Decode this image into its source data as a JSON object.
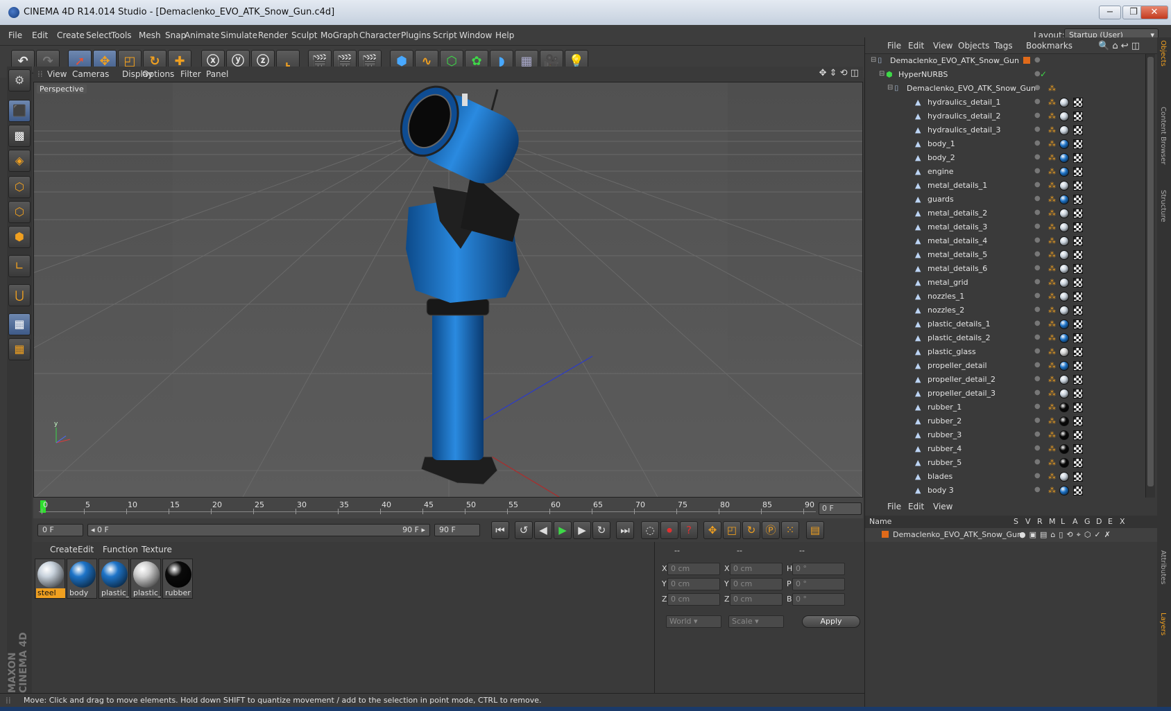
{
  "window": {
    "title": "CINEMA 4D R14.014 Studio - [Demaclenko_EVO_ATK_Snow_Gun.c4d]",
    "minimize": "−",
    "restore": "❐",
    "close": "✕"
  },
  "menubar": {
    "items": [
      "File",
      "Edit",
      "Create",
      "Select",
      "Tools",
      "Mesh",
      "Snap",
      "Animate",
      "Simulate",
      "Render",
      "Sculpt",
      "MoGraph",
      "Character",
      "Plugins",
      "Script",
      "Window",
      "Help"
    ],
    "layout_label": "Layout:",
    "layout_value": "Startup (User)"
  },
  "viewport": {
    "menu": [
      "View",
      "Cameras",
      "Display",
      "Options",
      "Filter",
      "Panel"
    ],
    "label": "Perspective"
  },
  "timeline": {
    "ticks": [
      "0",
      "5",
      "10",
      "15",
      "20",
      "25",
      "30",
      "35",
      "40",
      "45",
      "50",
      "55",
      "60",
      "65",
      "70",
      "75",
      "80",
      "85",
      "90"
    ],
    "current_frame": "0 F"
  },
  "transport": {
    "start_field": "0 F",
    "range_start": "◂ 0 F",
    "range_end": "90 F ▸",
    "end_field": "90 F"
  },
  "materials": {
    "menu": [
      "Create",
      "Edit",
      "Function",
      "Texture"
    ],
    "items": [
      {
        "name": "steel",
        "color": "#c8d2dc"
      },
      {
        "name": "body",
        "color": "#1e74c8"
      },
      {
        "name": "plastic_d",
        "color": "#1e74c8"
      },
      {
        "name": "plastic_g",
        "color": "#d0d0d0"
      },
      {
        "name": "rubber",
        "color": "#0a0a0a"
      }
    ]
  },
  "coordinates": {
    "headers": [
      "--",
      "--",
      "--"
    ],
    "rows": [
      {
        "a": "X",
        "av": "0 cm",
        "b": "X",
        "bv": "0 cm",
        "c": "H",
        "cv": "0 °"
      },
      {
        "a": "Y",
        "av": "0 cm",
        "b": "Y",
        "bv": "0 cm",
        "c": "P",
        "cv": "0 °"
      },
      {
        "a": "Z",
        "av": "0 cm",
        "b": "Z",
        "bv": "0 cm",
        "c": "B",
        "cv": "0 °"
      }
    ],
    "mode": "World",
    "scale": "Scale",
    "apply": "Apply"
  },
  "objects": {
    "menu": [
      "File",
      "Edit",
      "View",
      "Objects",
      "Tags",
      "Bookmarks"
    ],
    "items": [
      {
        "name": "Demaclenko_EVO_ATK_Snow_Gun",
        "indent": 0,
        "type": "null"
      },
      {
        "name": "HyperNURBS",
        "indent": 1,
        "type": "nurbs"
      },
      {
        "name": "Demaclenko_EVO_ATK_Snow_Gun",
        "indent": 2,
        "type": "null"
      },
      {
        "name": "hydraulics_detail_1",
        "indent": 3,
        "type": "poly",
        "mat": "#c8d2dc"
      },
      {
        "name": "hydraulics_detail_2",
        "indent": 3,
        "type": "poly",
        "mat": "#c8d2dc"
      },
      {
        "name": "hydraulics_detail_3",
        "indent": 3,
        "type": "poly",
        "mat": "#c8d2dc"
      },
      {
        "name": "body_1",
        "indent": 3,
        "type": "poly",
        "mat": "#1e74c8"
      },
      {
        "name": "body_2",
        "indent": 3,
        "type": "poly",
        "mat": "#1e74c8"
      },
      {
        "name": "engine",
        "indent": 3,
        "type": "poly",
        "mat": "#1e74c8"
      },
      {
        "name": "metal_details_1",
        "indent": 3,
        "type": "poly",
        "mat": "#c8d2dc"
      },
      {
        "name": "guards",
        "indent": 3,
        "type": "poly",
        "mat": "#1e74c8"
      },
      {
        "name": "metal_details_2",
        "indent": 3,
        "type": "poly",
        "mat": "#c8d2dc"
      },
      {
        "name": "metal_details_3",
        "indent": 3,
        "type": "poly",
        "mat": "#c8d2dc"
      },
      {
        "name": "metal_details_4",
        "indent": 3,
        "type": "poly",
        "mat": "#c8d2dc"
      },
      {
        "name": "metal_details_5",
        "indent": 3,
        "type": "poly",
        "mat": "#c8d2dc"
      },
      {
        "name": "metal_details_6",
        "indent": 3,
        "type": "poly",
        "mat": "#c8d2dc"
      },
      {
        "name": "metal_grid",
        "indent": 3,
        "type": "poly",
        "mat": "#c8d2dc"
      },
      {
        "name": "nozzles_1",
        "indent": 3,
        "type": "poly",
        "mat": "#c8d2dc"
      },
      {
        "name": "nozzles_2",
        "indent": 3,
        "type": "poly",
        "mat": "#c8d2dc"
      },
      {
        "name": "plastic_details_1",
        "indent": 3,
        "type": "poly",
        "mat": "#1e74c8"
      },
      {
        "name": "plastic_details_2",
        "indent": 3,
        "type": "poly",
        "mat": "#1e74c8"
      },
      {
        "name": "plastic_glass",
        "indent": 3,
        "type": "poly",
        "mat": "#d0d0d0"
      },
      {
        "name": "propeller_detail",
        "indent": 3,
        "type": "poly",
        "mat": "#1e74c8"
      },
      {
        "name": "propeller_detail_2",
        "indent": 3,
        "type": "poly",
        "mat": "#c8d2dc"
      },
      {
        "name": "propeller_detail_3",
        "indent": 3,
        "type": "poly",
        "mat": "#c8d2dc"
      },
      {
        "name": "rubber_1",
        "indent": 3,
        "type": "poly",
        "mat": "#0a0a0a"
      },
      {
        "name": "rubber_2",
        "indent": 3,
        "type": "poly",
        "mat": "#0a0a0a"
      },
      {
        "name": "rubber_3",
        "indent": 3,
        "type": "poly",
        "mat": "#0a0a0a"
      },
      {
        "name": "rubber_4",
        "indent": 3,
        "type": "poly",
        "mat": "#0a0a0a"
      },
      {
        "name": "rubber_5",
        "indent": 3,
        "type": "poly",
        "mat": "#0a0a0a"
      },
      {
        "name": "blades",
        "indent": 3,
        "type": "poly",
        "mat": "#c8d2dc"
      },
      {
        "name": "body 3",
        "indent": 3,
        "type": "poly",
        "mat": "#1e74c8"
      }
    ]
  },
  "layers": {
    "menu": [
      "File",
      "Edit",
      "View"
    ],
    "columns": [
      "Name",
      "S",
      "V",
      "R",
      "M",
      "L",
      "A",
      "G",
      "D",
      "E",
      "X"
    ],
    "row_name": "Demaclenko_EVO_ATK_Snow_Gun"
  },
  "sidetabs": [
    "Objects",
    "Content Browser",
    "Structure",
    "Attributes",
    "Layers"
  ],
  "statusbar": {
    "text": "Move: Click and drag to move elements. Hold down SHIFT to quantize movement / add to the selection in point mode, CTRL to remove."
  },
  "brand": "MAXON CINEMA 4D",
  "colors": {
    "accent": "#f0a020",
    "selection": "#3e5a88",
    "model_blue": "#1e74c8"
  }
}
